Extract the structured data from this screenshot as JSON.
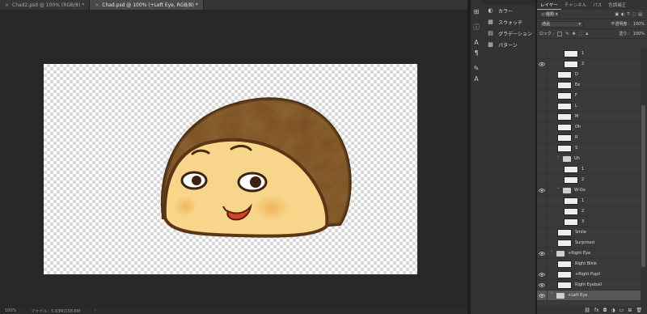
{
  "tabs": [
    {
      "label": "Chad2.psd @ 100% (RGB/8) *",
      "active": false
    },
    {
      "label": "Chad.psd @ 100% (+Left Eye, RGB/8) *",
      "active": true
    }
  ],
  "status": {
    "zoom": "100%",
    "file": "ファイル : 5.93M/158.6M",
    "arrow": "›"
  },
  "mini_panel": {
    "items": [
      {
        "label": "カラー",
        "icon": "color-wheel-icon"
      },
      {
        "label": "スウォッチ",
        "icon": "swatches-grid-icon"
      },
      {
        "label": "グラデーション",
        "icon": "gradient-icon"
      },
      {
        "label": "パターン",
        "icon": "pattern-grid-icon"
      }
    ]
  },
  "layers_panel": {
    "tabs": [
      "レイヤー",
      "チャンネル",
      "パス",
      "色調補正"
    ],
    "filter_label": "種類",
    "blend_mode": "通過",
    "opacity_label": "不透明度 :",
    "opacity_value": "100%",
    "lock_label": "ロック :",
    "fill_label": "塗り :",
    "fill_value": "100%",
    "layers": [
      {
        "name": "1",
        "visible": false,
        "indent": 2,
        "type": "layer"
      },
      {
        "name": "2",
        "visible": true,
        "indent": 2,
        "type": "layer"
      },
      {
        "name": "D",
        "visible": false,
        "indent": 1,
        "type": "layer"
      },
      {
        "name": "Ee",
        "visible": false,
        "indent": 1,
        "type": "layer"
      },
      {
        "name": "F",
        "visible": false,
        "indent": 1,
        "type": "layer"
      },
      {
        "name": "L",
        "visible": false,
        "indent": 1,
        "type": "layer"
      },
      {
        "name": "M",
        "visible": false,
        "indent": 1,
        "type": "layer"
      },
      {
        "name": "Oh",
        "visible": false,
        "indent": 1,
        "type": "layer"
      },
      {
        "name": "R",
        "visible": false,
        "indent": 1,
        "type": "layer"
      },
      {
        "name": "S",
        "visible": false,
        "indent": 1,
        "type": "layer"
      },
      {
        "name": "Uh",
        "visible": false,
        "indent": 1,
        "type": "group"
      },
      {
        "name": "1",
        "visible": false,
        "indent": 2,
        "type": "layer"
      },
      {
        "name": "2",
        "visible": false,
        "indent": 2,
        "type": "layer"
      },
      {
        "name": "W-Oo",
        "visible": true,
        "indent": 1,
        "type": "group"
      },
      {
        "name": "1",
        "visible": false,
        "indent": 2,
        "type": "layer"
      },
      {
        "name": "2",
        "visible": false,
        "indent": 2,
        "type": "layer"
      },
      {
        "name": "3",
        "visible": false,
        "indent": 2,
        "type": "layer"
      },
      {
        "name": "Smile",
        "visible": false,
        "indent": 1,
        "type": "layer"
      },
      {
        "name": "Surprised",
        "visible": false,
        "indent": 1,
        "type": "layer"
      },
      {
        "name": "+Right Eye",
        "visible": true,
        "indent": 0,
        "type": "group"
      },
      {
        "name": "Right Blink",
        "visible": false,
        "indent": 1,
        "type": "layer"
      },
      {
        "name": "+Right Pupil",
        "visible": true,
        "indent": 1,
        "type": "layer"
      },
      {
        "name": "Right Eyeball",
        "visible": true,
        "indent": 1,
        "type": "layer"
      },
      {
        "name": "+Left Eye",
        "visible": true,
        "indent": 0,
        "type": "group",
        "selected": true
      }
    ],
    "footer_icons": [
      "link-icon",
      "fx-icon",
      "mask-icon",
      "adjustment-icon",
      "folder-icon",
      "new-layer-icon",
      "trash-icon"
    ]
  },
  "colors": {
    "hair": "#7a4e23",
    "skin": "#f7d58a",
    "outline": "#5a3516",
    "cheek": "#f1b65c",
    "mouth": "#d9432c"
  }
}
